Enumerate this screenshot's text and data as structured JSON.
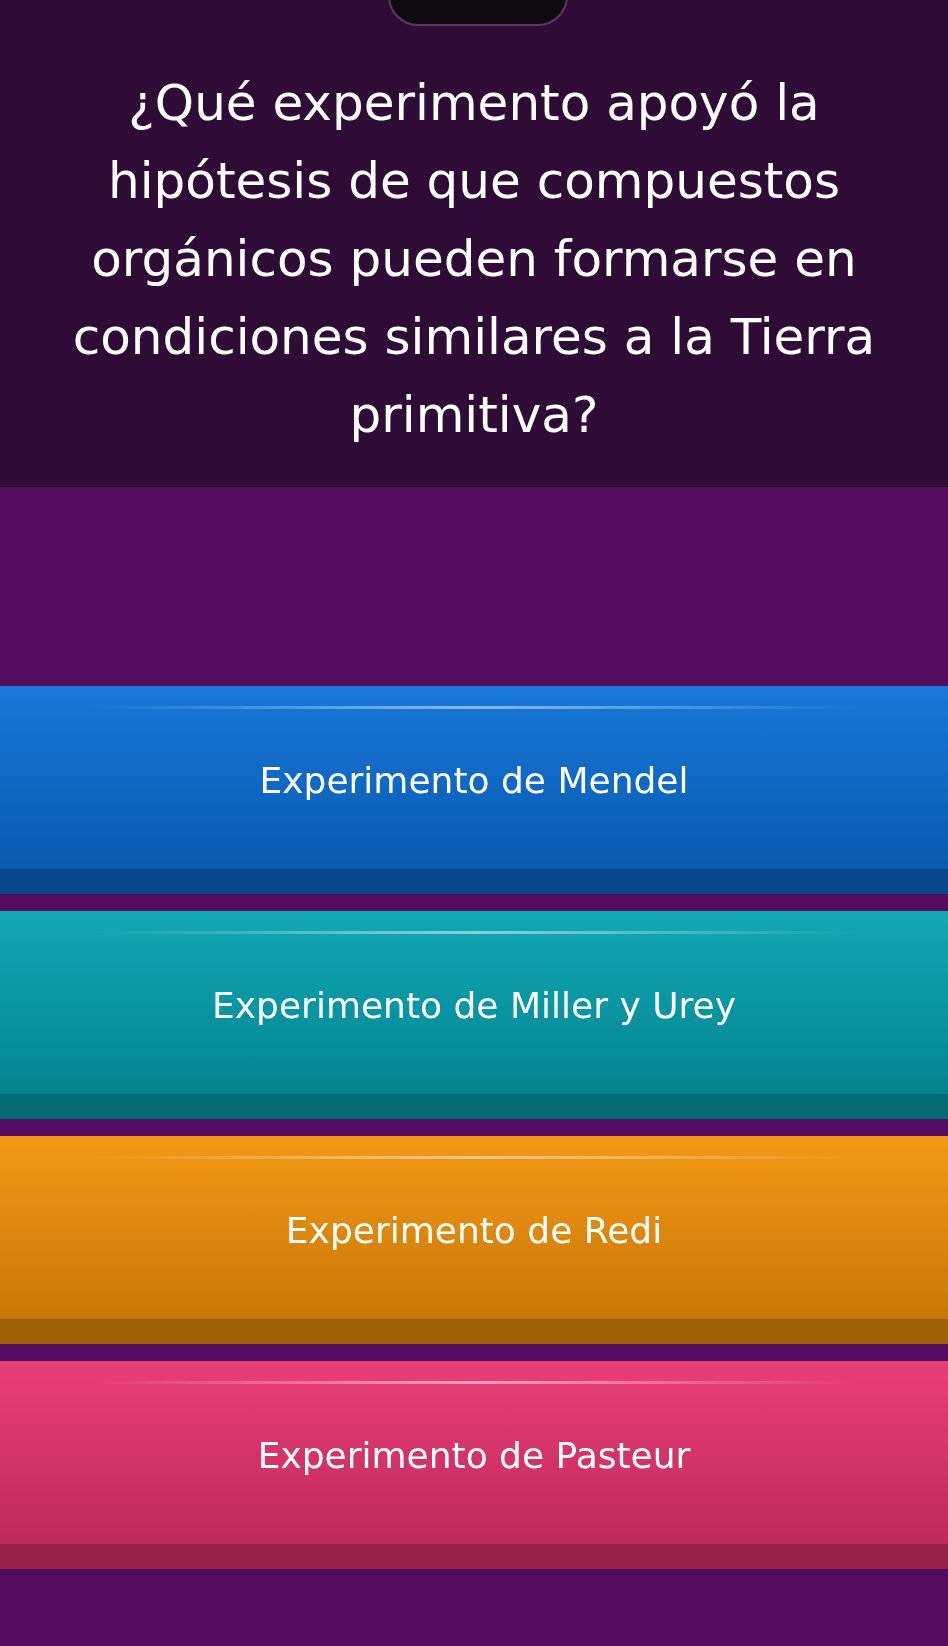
{
  "question": "¿Qué experimento apoyó la hipótesis de que compuestos orgánicos pueden formarse en condiciones similares a la Tierra primitiva?",
  "options": [
    {
      "label": "Experimento de Mendel",
      "color": "#0a6fd6"
    },
    {
      "label": "Experimento de Miller y Urey",
      "color": "#03a2b0"
    },
    {
      "label": "Experimento de Redi",
      "color": "#f39208"
    },
    {
      "label": "Experimento de Pasteur",
      "color": "#e8336e"
    }
  ]
}
